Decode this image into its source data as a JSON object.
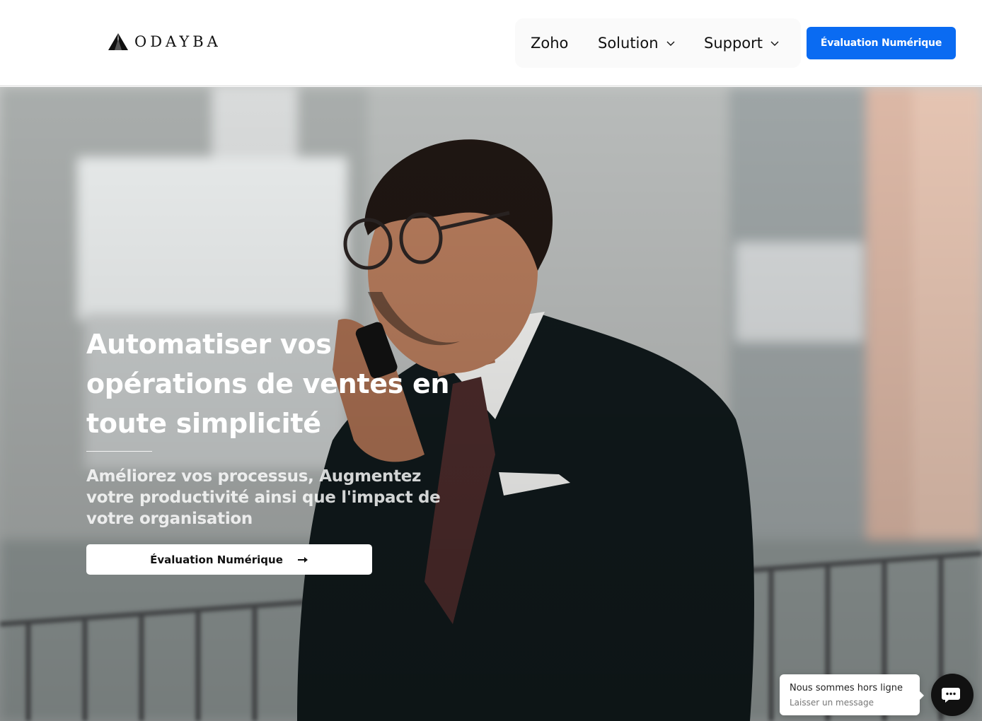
{
  "header": {
    "logo_text": "ODAYBA",
    "nav": {
      "zoho": "Zoho",
      "solution": "Solution",
      "support": "Support"
    },
    "cta_label": "Évaluation Numérique"
  },
  "hero": {
    "headline": "Automatiser vos opérations de ventes en toute simplicité",
    "subheadline": "Améliorez vos processus, Augmentez votre productivité ainsi que l'impact de votre organisation",
    "cta_label": "Évaluation Numérique",
    "image_subject": "man in suit on phone call, balcony, blurred building background"
  },
  "chat": {
    "status": "Nous sommes hors ligne",
    "action": "Laisser un message"
  },
  "colors": {
    "primary": "#0a6bf2",
    "dark": "#111111",
    "white": "#ffffff"
  },
  "icons": [
    "odayba-logo-icon",
    "chevron-down-icon",
    "arrow-right-icon",
    "chat-icon"
  ]
}
